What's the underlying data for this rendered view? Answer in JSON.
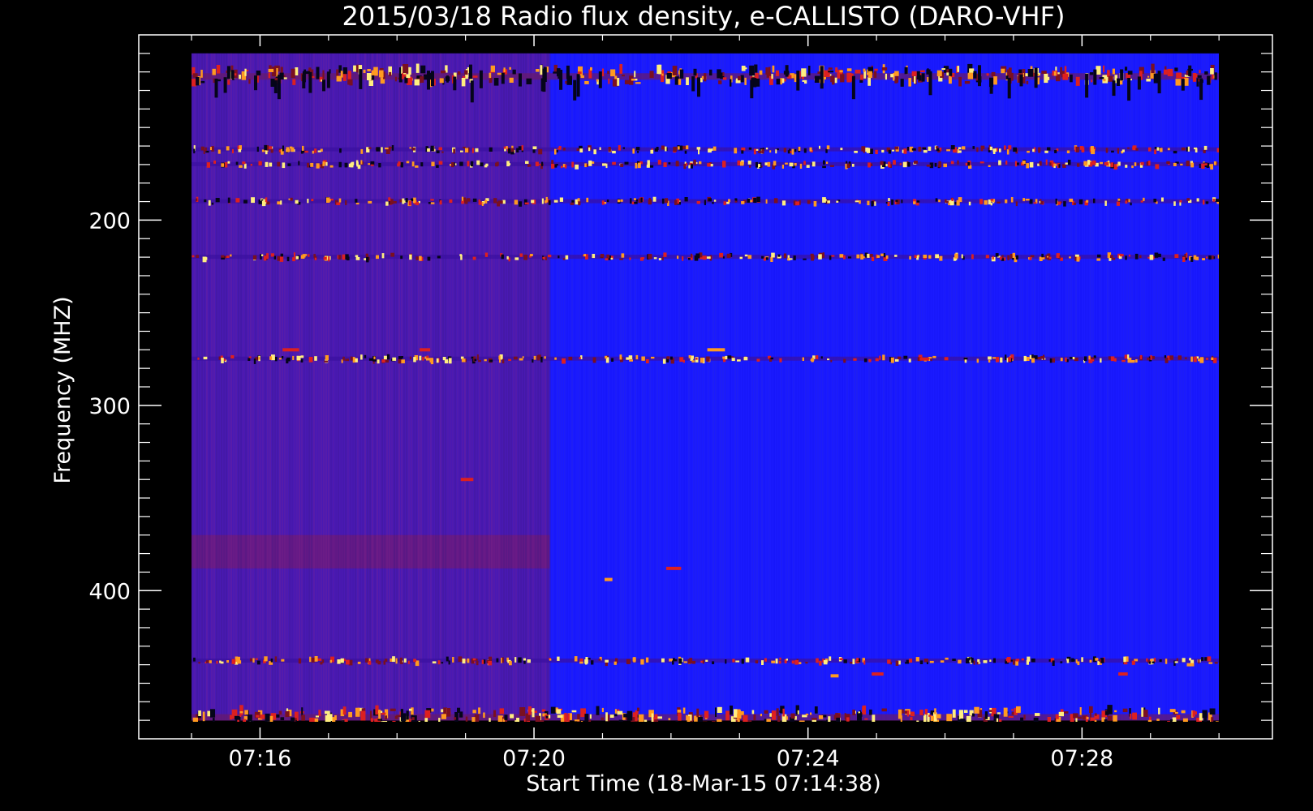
{
  "chart_data": {
    "type": "heatmap",
    "title": "2015/03/18  Radio flux density, e-CALLISTO (DARO-VHF)",
    "xlabel": "Start Time (18-Mar-15 07:14:38)",
    "ylabel": "Frequency (MHZ)",
    "x_ticks": [
      "07:16",
      "07:20",
      "07:24",
      "07:28"
    ],
    "x_tick_values_min": [
      1.37,
      5.37,
      9.37,
      13.37
    ],
    "x_data_range_min": [
      0.37,
      15.37
    ],
    "xlim_min": [
      -0.4,
      16.15
    ],
    "y_ticks": [
      "200",
      "300",
      "400"
    ],
    "y_tick_values": [
      200,
      300,
      400
    ],
    "y_data_range": [
      110,
      470
    ],
    "ylim": [
      100,
      480
    ],
    "y_minor_step": 10,
    "x_minor_step_min": 1,
    "colors": {
      "background": "#000000",
      "axes": "#ffffff",
      "base_blue": "#1a1aff",
      "purple": "#5a1a9a",
      "red": "#dd2020",
      "orange": "#ff9a20",
      "yellow": "#ffee80",
      "dark": "#05051a"
    },
    "features": {
      "enhanced_block_until_min": 5.6,
      "interference_bands_mhz": [
        122,
        162,
        170,
        190,
        220,
        275,
        438,
        468
      ],
      "grid": false,
      "legend": "none"
    }
  }
}
